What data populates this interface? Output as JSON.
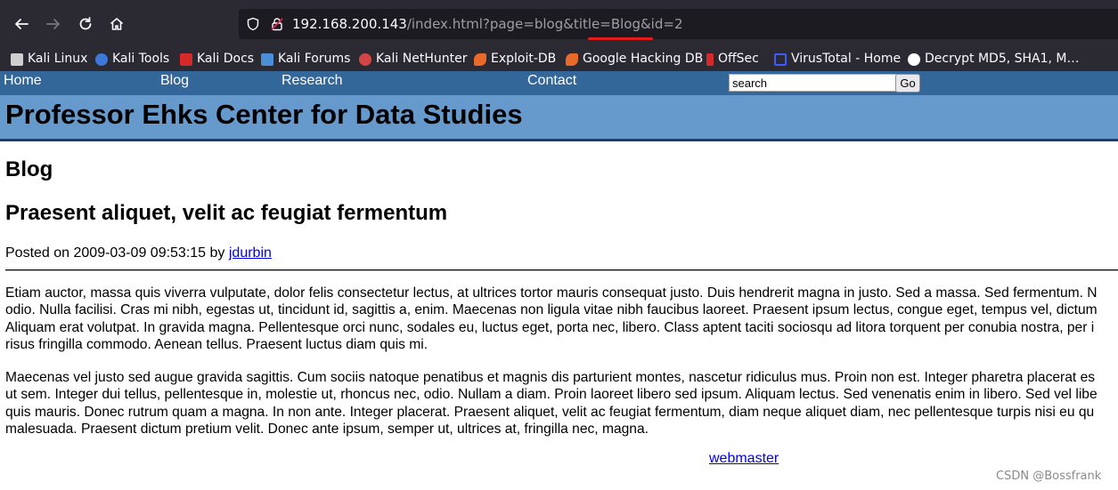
{
  "browser": {
    "url_host": "192.168.200.143",
    "url_rest": "/index.html?page=blog&title=Blog&id=2",
    "bookmarks": [
      {
        "label": "Kali Linux",
        "icon": "kali-dragon-icon",
        "color": "#cfcfcf"
      },
      {
        "label": "Kali Tools",
        "icon": "kali-tools-icon",
        "color": "#3b78d8"
      },
      {
        "label": "Kali Docs",
        "icon": "kali-docs-icon",
        "color": "#d62a2a"
      },
      {
        "label": "Kali Forums",
        "icon": "kali-forums-icon",
        "color": "#4a8ed8"
      },
      {
        "label": "Kali NetHunter",
        "icon": "nethunter-icon",
        "color": "#d64545"
      },
      {
        "label": "Exploit-DB",
        "icon": "exploit-db-icon",
        "color": "#e8692a"
      },
      {
        "label": "Google Hacking DB",
        "icon": "ghdb-icon",
        "color": "#e8692a"
      },
      {
        "label": "OffSec",
        "icon": "offsec-icon",
        "color": "#d62a2a"
      },
      {
        "label": "VirusTotal - Home",
        "icon": "virustotal-icon",
        "color": "#3d5afe"
      },
      {
        "label": "Decrypt MD5, SHA1, M…",
        "icon": "decrypt-icon",
        "color": "#ffffff"
      }
    ]
  },
  "site": {
    "nav": [
      "Home",
      "Blog",
      "Research",
      "Contact"
    ],
    "search_value": "search",
    "go_label": "Go",
    "title": "Professor Ehks Center for Data Studies"
  },
  "page": {
    "heading": "Blog",
    "post_title": "Praesent aliquet, velit ac feugiat fermentum",
    "posted_prefix": "Posted on 2009-03-09 09:53:15 by",
    "author": "jdurbin",
    "paragraph1": [
      "Etiam auctor, massa quis viverra vulputate, dolor felis consectetur lectus, at ultrices tortor mauris consequat justo. Duis hendrerit magna in justo. Sed a massa. Sed fermentum. N",
      "odio. Nulla facilisi. Cras mi nibh, egestas ut, tincidunt id, sagittis a, enim. Maecenas non ligula vitae nibh faucibus laoreet. Praesent ipsum lectus, congue eget, tempus vel, dictum",
      "Aliquam erat volutpat. In gravida magna. Pellentesque orci nunc, sodales eu, luctus eget, porta nec, libero. Class aptent taciti sociosqu ad litora torquent per conubia nostra, per i",
      "risus fringilla commodo. Aenean tellus. Praesent luctus diam quis mi."
    ],
    "paragraph2": [
      "Maecenas vel justo sed augue gravida sagittis. Cum sociis natoque penatibus et magnis dis parturient montes, nascetur ridiculus mus. Proin non est. Integer pharetra placerat es",
      "ut sem. Integer dui tellus, pellentesque in, molestie ut, rhoncus nec, odio. Nullam a diam. Proin laoreet libero sed ipsum. Aliquam lectus. Sed venenatis enim in libero. Sed vel libe",
      "quis mauris. Donec rutrum quam a magna. In non ante. Integer placerat. Praesent aliquet, velit ac feugiat fermentum, diam neque aliquet diam, nec pellentesque turpis nisi eu qu",
      "malesuada. Praesent dictum pretium velit. Donec ante ipsum, semper ut, ultrices at, fringilla nec, magna."
    ],
    "footer_link": "webmaster"
  },
  "watermark": "CSDN @Bossfrank",
  "colors": {
    "nav_bar": "#336699",
    "banner": "#6699cc",
    "link": "#0000ee",
    "annotation_red": "#e31b1b"
  }
}
